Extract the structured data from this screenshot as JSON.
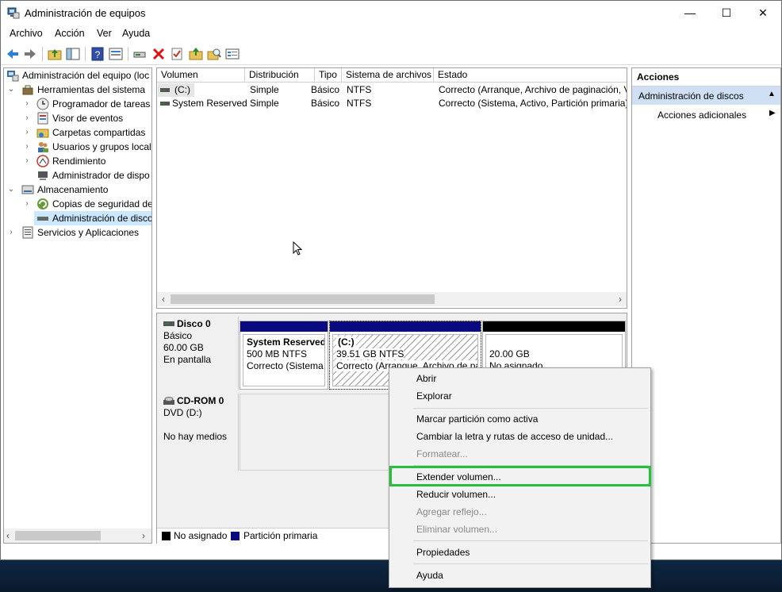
{
  "window": {
    "title": "Administración de equipos",
    "controls": {
      "minimize": "—",
      "maximize": "☐",
      "close": "✕"
    }
  },
  "menubar": [
    "Archivo",
    "Acción",
    "Ver",
    "Ayuda"
  ],
  "tree": {
    "root": "Administración del equipo (loc",
    "items": [
      {
        "label": "Herramientas del sistema",
        "icon": "tools-icon"
      },
      {
        "label": "Programador de tareas",
        "icon": "clock-icon"
      },
      {
        "label": "Visor de eventos",
        "icon": "event-viewer-icon"
      },
      {
        "label": "Carpetas compartidas",
        "icon": "shared-folder-icon"
      },
      {
        "label": "Usuarios y grupos locale",
        "icon": "users-icon"
      },
      {
        "label": "Rendimiento",
        "icon": "performance-icon"
      },
      {
        "label": "Administrador de dispo",
        "icon": "device-manager-icon"
      },
      {
        "label": "Almacenamiento",
        "icon": "storage-icon"
      },
      {
        "label": "Copias de seguridad de",
        "icon": "backup-icon"
      },
      {
        "label": "Administración de disco",
        "icon": "disk-icon"
      },
      {
        "label": "Servicios y Aplicaciones",
        "icon": "services-icon"
      }
    ]
  },
  "volumes": {
    "columns": [
      "Volumen",
      "Distribución",
      "Tipo",
      "Sistema de archivos",
      "Estado"
    ],
    "rows": [
      [
        "(C:)",
        "Simple",
        "Básico",
        "NTFS",
        "Correcto (Arranque, Archivo de paginación, V"
      ],
      [
        "System Reserved",
        "Simple",
        "Básico",
        "NTFS",
        "Correcto (Sistema, Activo, Partición primaria)"
      ]
    ]
  },
  "disks": [
    {
      "name": "Disco 0",
      "lines": [
        "Básico",
        "60.00 GB",
        "En pantalla"
      ]
    },
    {
      "name": "CD-ROM 0",
      "lines": [
        "DVD (D:)",
        "",
        "No hay medios"
      ]
    }
  ],
  "partitions": [
    {
      "title": "System Reserved",
      "size": "500 MB NTFS",
      "status": "Correcto (Sistema,",
      "bar_color": "#0a0a80"
    },
    {
      "title": "(C:)",
      "size": "39.51 GB NTFS",
      "status": "Correcto (Arranque, Archivo de pa",
      "bar_color": "#0a0a80"
    },
    {
      "title": "",
      "size": "20.00 GB",
      "status": "No asignado",
      "bar_color": "#000000"
    }
  ],
  "legend": [
    {
      "label": "No asignado",
      "color": "#000000"
    },
    {
      "label": "Partición primaria",
      "color": "#0a0a80"
    }
  ],
  "actions": {
    "header": "Acciones",
    "section": "Administración de discos",
    "item": "Acciones adicionales"
  },
  "context_menu": [
    {
      "label": "Abrir",
      "enabled": true
    },
    {
      "label": "Explorar",
      "enabled": true
    },
    {
      "label": "Marcar partición como activa",
      "enabled": true
    },
    {
      "label": "Cambiar la letra y rutas de acceso de unidad...",
      "enabled": true
    },
    {
      "label": "Formatear...",
      "enabled": false
    },
    {
      "label": "Extender volumen...",
      "enabled": true
    },
    {
      "label": "Reducir volumen...",
      "enabled": true
    },
    {
      "label": "Agregar reflejo...",
      "enabled": false
    },
    {
      "label": "Eliminar volumen...",
      "enabled": false
    },
    {
      "label": "Propiedades",
      "enabled": true
    },
    {
      "label": "Ayuda",
      "enabled": true
    }
  ],
  "colors": {
    "accent": "#0a0a80",
    "highlight": "#22c33a",
    "selection": "#cce8ff"
  }
}
